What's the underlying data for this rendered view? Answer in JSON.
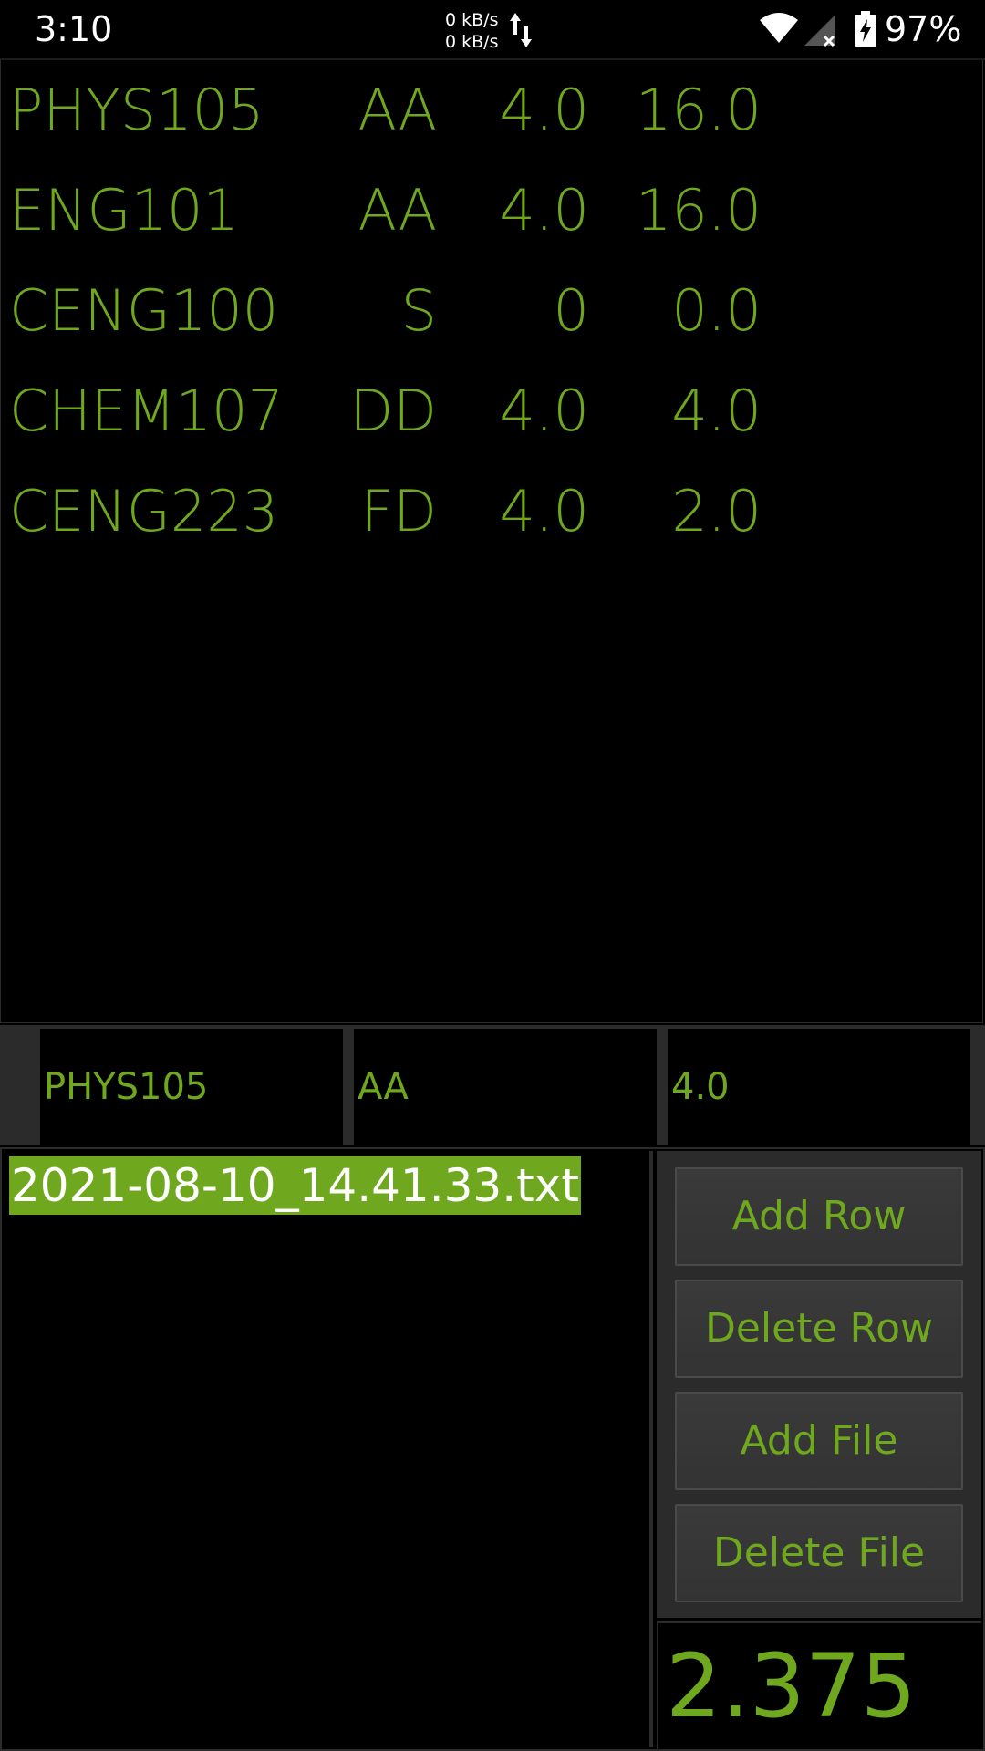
{
  "status_bar": {
    "time": "3:10",
    "net_up": "0 kB/s",
    "net_down": "0 kB/s",
    "battery": "97%"
  },
  "grades": [
    {
      "course": "PHYS105",
      "grade": "AA",
      "credit": "4.0",
      "points": "16.0"
    },
    {
      "course": "ENG101",
      "grade": "AA",
      "credit": "4.0",
      "points": "16.0"
    },
    {
      "course": "CENG100",
      "grade": "S",
      "credit": "0",
      "points": "0.0"
    },
    {
      "course": "CHEM107",
      "grade": "DD",
      "credit": "4.0",
      "points": "4.0"
    },
    {
      "course": "CENG223",
      "grade": "FD",
      "credit": "4.0",
      "points": "2.0"
    }
  ],
  "inputs": {
    "course": "PHYS105",
    "grade": "AA",
    "credit": "4.0"
  },
  "files": [
    "2021-08-10_14.41.33.txt"
  ],
  "buttons": {
    "add_row": "Add Row",
    "delete_row": "Delete Row",
    "add_file": "Add File",
    "delete_file": "Delete File"
  },
  "gpa": "2.375",
  "colors": {
    "accent": "#6fa81f",
    "background": "#000000",
    "panel": "#2b2b2b"
  }
}
